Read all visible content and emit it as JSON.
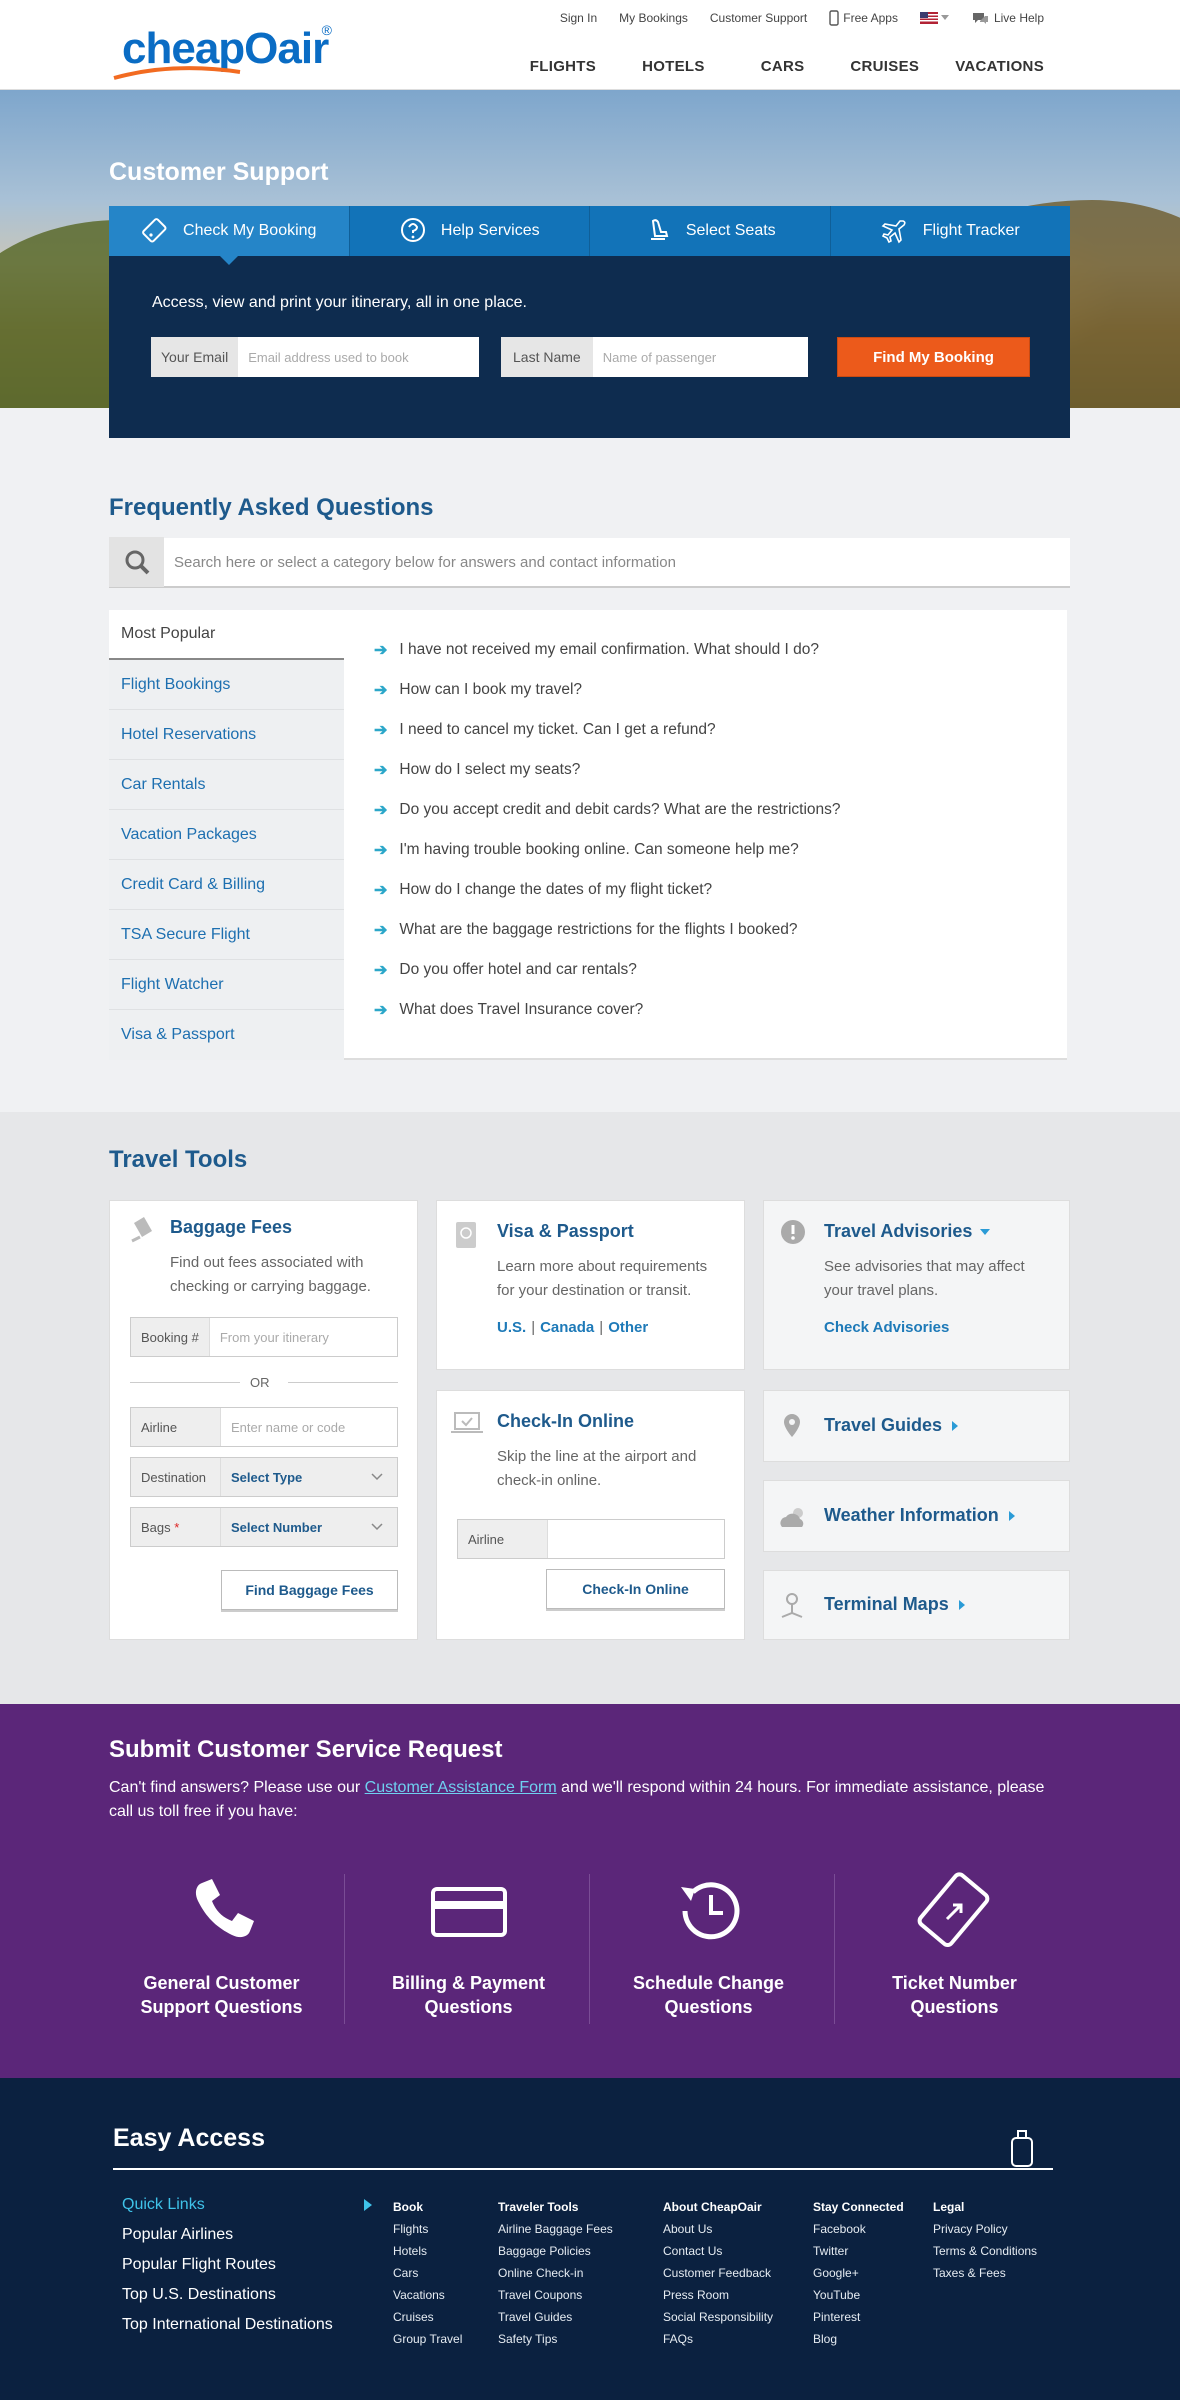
{
  "header": {
    "logo_text": "cheapOair",
    "logo_reg": "®",
    "top_links": [
      "Sign In",
      "My Bookings",
      "Customer Support",
      "Free Apps",
      "Live Help"
    ],
    "nav": [
      "FLIGHTS",
      "HOTELS",
      "CARS",
      "CRUISES",
      "VACATIONS"
    ]
  },
  "hero": {
    "title": "Customer Support",
    "tabs": [
      {
        "label": "Check My Booking",
        "icon": "ticket-icon"
      },
      {
        "label": "Help Services",
        "icon": "question-icon"
      },
      {
        "label": "Select Seats",
        "icon": "seat-icon"
      },
      {
        "label": "Flight Tracker",
        "icon": "plane-icon"
      }
    ],
    "text": "Access, view and print your itinerary, all in one place.",
    "email_label": "Your Email",
    "email_placeholder": "Email address used to book",
    "lastname_label": "Last Name",
    "lastname_placeholder": "Name of passenger",
    "find_button": "Find My Booking"
  },
  "faq": {
    "title": "Frequently Asked Questions",
    "search_placeholder": "Search here or select a category below for answers and contact information",
    "categories": [
      "Most Popular",
      "Flight Bookings",
      "Hotel Reservations",
      "Car Rentals",
      "Vacation Packages",
      "Credit Card & Billing",
      "TSA Secure Flight",
      "Flight Watcher",
      "Visa & Passport"
    ],
    "questions": [
      "I have not received my email confirmation. What should I do?",
      "How can I book my travel?",
      "I need to cancel my ticket. Can I get a refund?",
      "How do I select my seats?",
      "Do you accept credit and debit cards? What are the restrictions?",
      "I'm having trouble booking online. Can someone help me?",
      "How do I change the dates of my flight ticket?",
      "What are the baggage restrictions for the flights I booked?",
      "Do you offer hotel and car rentals?",
      "What does Travel Insurance cover?"
    ]
  },
  "tools": {
    "title": "Travel Tools",
    "baggage": {
      "title": "Baggage Fees",
      "desc": "Find out fees associated with checking or carrying baggage.",
      "booking_label": "Booking #",
      "booking_placeholder": "From your itinerary",
      "or": "OR",
      "airline_label": "Airline",
      "airline_placeholder": "Enter name or code",
      "destination_label": "Destination",
      "destination_value": "Select Type",
      "bags_label": "Bags",
      "bags_required": "*",
      "bags_value": "Select Number",
      "button": "Find Baggage Fees"
    },
    "visa": {
      "title": "Visa & Passport",
      "desc": "Learn more about requirements for your destination or transit.",
      "links": [
        "U.S.",
        "Canada",
        "Other"
      ],
      "sep": "|"
    },
    "advisories": {
      "title": "Travel Advisories",
      "desc": "See advisories that may affect your travel plans.",
      "link": "Check Advisories"
    },
    "checkin": {
      "title": "Check-In Online",
      "desc": "Skip the line at the airport and check-in online.",
      "airline_label": "Airline",
      "button": "Check-In Online"
    },
    "guides": "Travel Guides",
    "weather": "Weather Information",
    "terminal": "Terminal Maps"
  },
  "request": {
    "title": "Submit Customer Service Request",
    "text_before": "Can't find answers? Please use our ",
    "link": "Customer Assistance Form",
    "text_after": "  and we'll respond within 24 hours. For immediate assistance, please call us toll free if you have:",
    "items": [
      {
        "line1": "General Customer",
        "line2": "Support Questions"
      },
      {
        "line1": "Billing & Payment",
        "line2": "Questions"
      },
      {
        "line1": "Schedule Change",
        "line2": "Questions"
      },
      {
        "line1": "Ticket Number",
        "line2": "Questions"
      }
    ]
  },
  "footer": {
    "title": "Easy Access",
    "links": [
      "Quick Links",
      "Popular Airlines",
      "Popular Flight Routes",
      "Top U.S. Destinations",
      "Top International Destinations"
    ],
    "columns": [
      {
        "head": "Book",
        "items": [
          "Flights",
          "Hotels",
          "Cars",
          "Vacations",
          "Cruises",
          "Group Travel"
        ]
      },
      {
        "head": "Traveler Tools",
        "items": [
          "Airline Baggage Fees",
          "Baggage Policies",
          "Online Check-in",
          "Travel Coupons",
          "Travel Guides",
          "Safety Tips"
        ]
      },
      {
        "head": "About CheapOair",
        "items": [
          "About Us",
          "Contact Us",
          "Customer Feedback",
          "Press Room",
          "Social Responsibility",
          "FAQs"
        ]
      },
      {
        "head": "Stay Connected",
        "items": [
          "Facebook",
          "Twitter",
          "Google+",
          "YouTube",
          "Pinterest",
          "Blog"
        ]
      },
      {
        "head": "Legal",
        "items": [
          "Privacy Policy",
          "Terms & Conditions",
          "Taxes & Fees"
        ]
      }
    ]
  },
  "colors": {
    "brand_blue": "#0a6cc4",
    "tab_blue": "#1273b8",
    "panel_navy": "#0e2c4f",
    "cta_orange": "#ec5a1b",
    "purple": "#5b2679",
    "footer_navy": "#0b2140"
  }
}
